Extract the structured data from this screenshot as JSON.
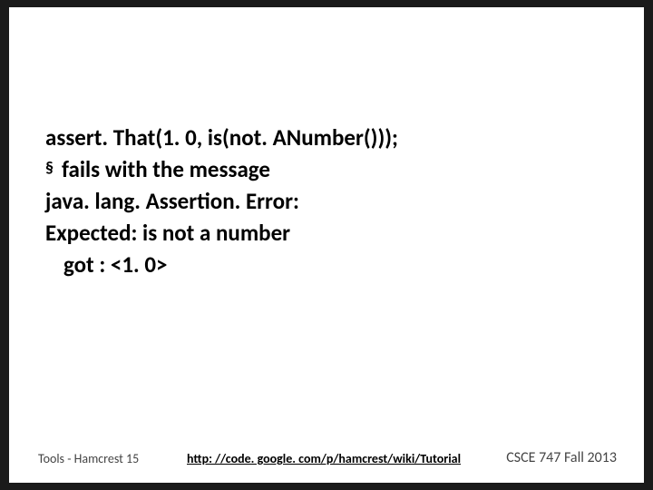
{
  "content": {
    "line1": "assert. That(1. 0, is(not. ANumber()));",
    "bullet": "§",
    "line2": "fails with the message",
    "line3": "java. lang. Assertion. Error:",
    "line4": "Expected: is not a number",
    "line5": "got : <1. 0>"
  },
  "footer": {
    "left": "Tools - Hamcrest  15",
    "center": "http: //code. google. com/p/hamcrest/wiki/Tutorial",
    "right": "CSCE 747 Fall 2013"
  }
}
